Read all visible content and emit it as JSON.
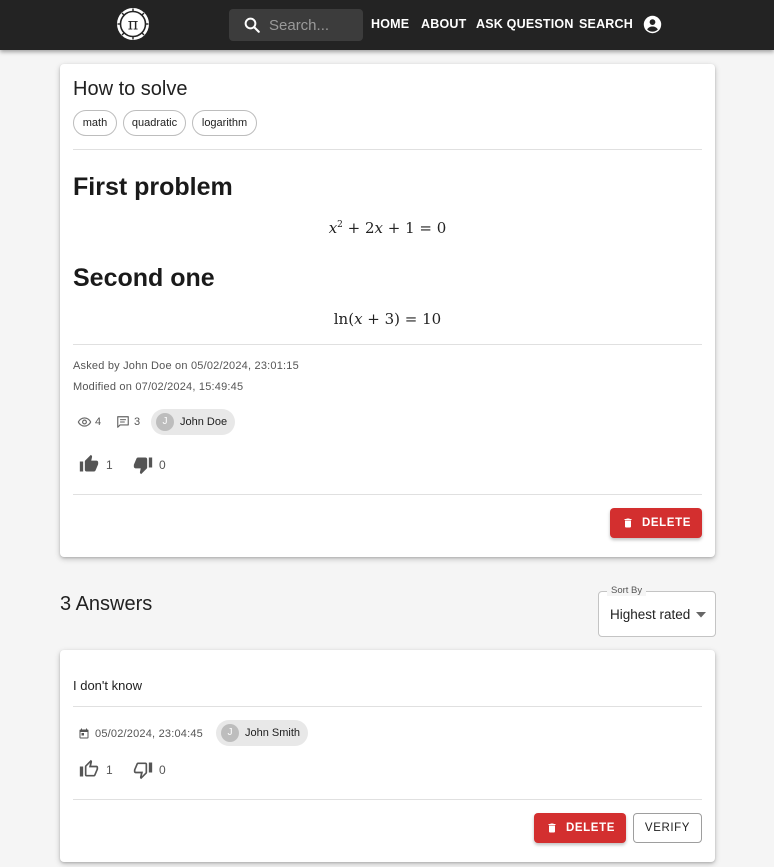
{
  "nav": {
    "search_placeholder": "Search...",
    "links": [
      "HOME",
      "ABOUT",
      "ASK QUESTION",
      "SEARCH"
    ]
  },
  "question": {
    "title": "How to solve",
    "tags": [
      "math",
      "quadratic",
      "logarithm"
    ],
    "heading1": "First problem",
    "equation1": {
      "x": "x",
      "sup": "2",
      "rest": " + 2",
      "x2": "x",
      "tail": " + 1 = 0"
    },
    "heading2": "Second one",
    "equation2": {
      "ln": "ln(",
      "x": "x",
      "tail": " + 3) = 10"
    },
    "asked": "Asked by John Doe on 05/02/2024, 23:01:15",
    "modified": "Modified on 07/02/2024, 15:49:45",
    "views": "4",
    "comments": "3",
    "author_initial": "J",
    "author": "John Doe",
    "upvotes": "1",
    "downvotes": "0",
    "delete_label": "DELETE"
  },
  "answers": {
    "title": "3 Answers",
    "sort_label": "Sort By",
    "sort_value": "Highest rated",
    "items": [
      {
        "text": "I don't know",
        "date": "05/02/2024, 23:04:45",
        "author_initial": "J",
        "author": "John Smith",
        "upvotes": "1",
        "downvotes": "0",
        "delete_label": "DELETE",
        "verify_label": "VERIFY"
      }
    ]
  },
  "colors": {
    "appbar": "#232323",
    "danger": "#d32f2f",
    "background": "#f5f5f5"
  },
  "icons": [
    "pi-logo-icon",
    "search-icon",
    "account-circle-icon",
    "eye-icon",
    "comment-icon",
    "thumb-up-icon",
    "thumb-down-icon",
    "trash-icon",
    "calendar-icon",
    "dropdown-arrow-icon"
  ]
}
